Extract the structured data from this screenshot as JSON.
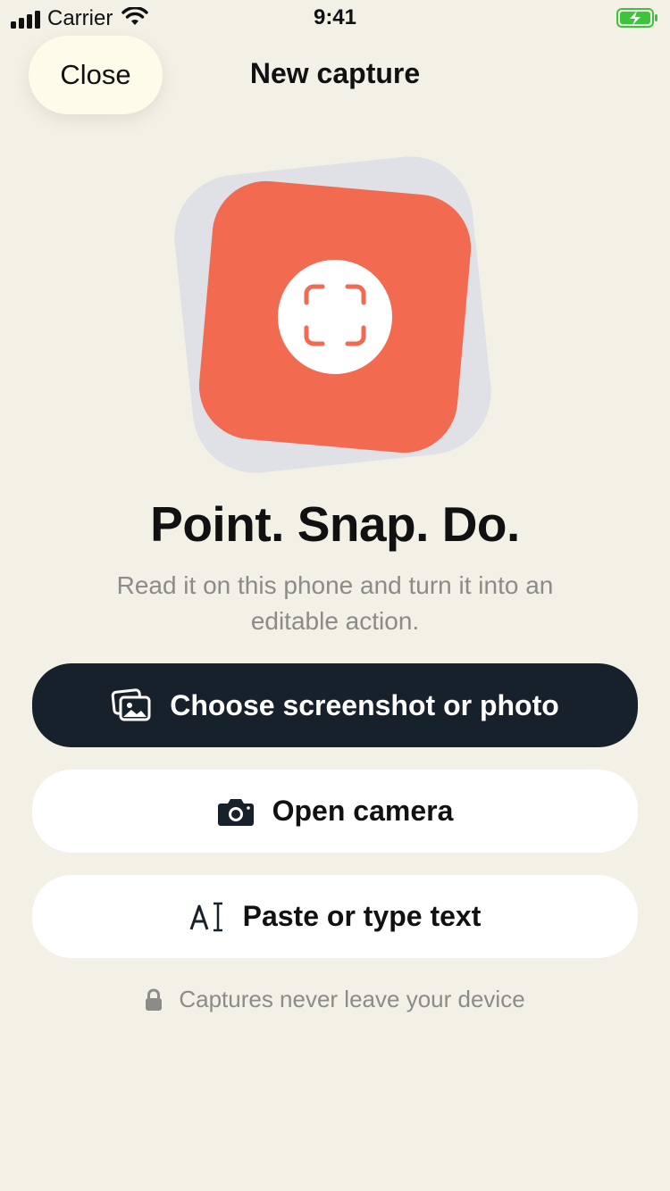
{
  "status_bar": {
    "carrier": "Carrier",
    "time": "9:41",
    "icons": [
      "signal-icon",
      "wifi-icon",
      "battery-charging-icon"
    ]
  },
  "nav": {
    "close_label": "Close",
    "title": "New capture"
  },
  "hero": {
    "icon": "scan-frame-icon",
    "colors": {
      "back_card": "#dfe1e6",
      "front_card": "#f26b50",
      "circle": "#ffffff"
    }
  },
  "headline": "Point. Snap. Do.",
  "subtext": "Read it on this phone and turn it into an editable action.",
  "actions": {
    "choose_photo": {
      "label": "Choose screenshot or photo",
      "icon": "photo-stack-icon"
    },
    "open_camera": {
      "label": "Open camera",
      "icon": "camera-icon"
    },
    "paste_text": {
      "label": "Paste or type text",
      "icon": "text-cursor-icon"
    }
  },
  "privacy": {
    "label": "Captures never leave your device",
    "icon": "lock-icon"
  },
  "colors": {
    "background": "#f3f0e6",
    "primary_button": "#17212b",
    "accent": "#f26b50",
    "muted_text": "#8d8b87",
    "battery": "#3cc43c"
  }
}
